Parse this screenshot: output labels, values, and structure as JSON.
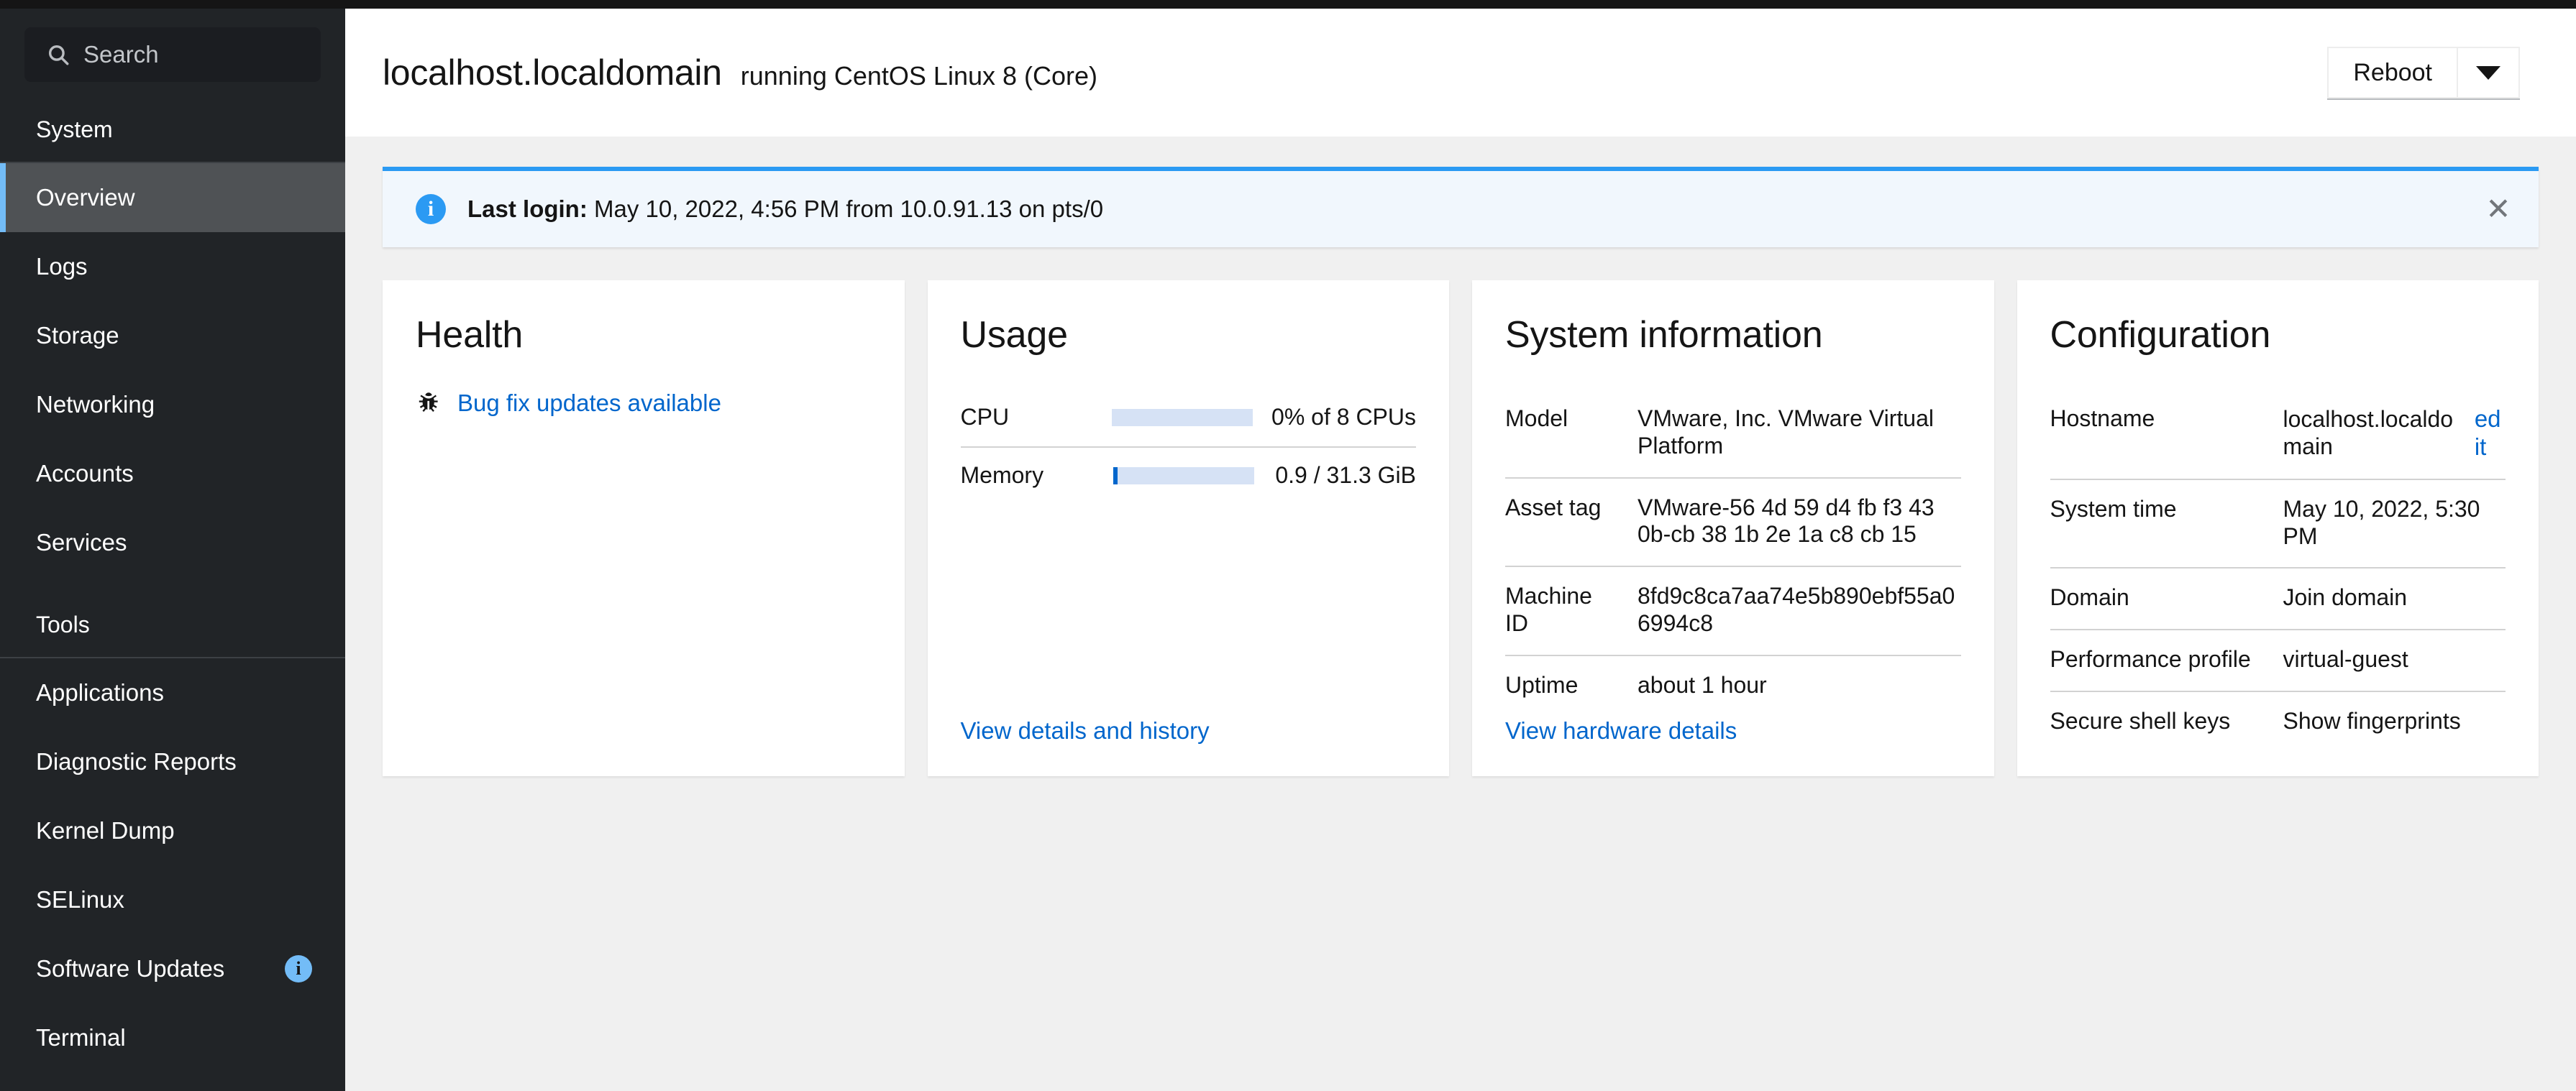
{
  "sidebar": {
    "search": {
      "placeholder": "Search",
      "value": "",
      "icon": "search-icon"
    },
    "sections": [
      {
        "label": "System",
        "items": [
          {
            "label": "Overview",
            "active": true
          },
          {
            "label": "Logs",
            "active": false
          },
          {
            "label": "Storage",
            "active": false
          },
          {
            "label": "Networking",
            "active": false
          },
          {
            "label": "Accounts",
            "active": false
          },
          {
            "label": "Services",
            "active": false
          }
        ]
      },
      {
        "label": "Tools",
        "items": [
          {
            "label": "Applications",
            "active": false
          },
          {
            "label": "Diagnostic Reports",
            "active": false
          },
          {
            "label": "Kernel Dump",
            "active": false
          },
          {
            "label": "SELinux",
            "active": false
          },
          {
            "label": "Software Updates",
            "active": false,
            "badge": "i"
          },
          {
            "label": "Terminal",
            "active": false
          }
        ]
      }
    ]
  },
  "header": {
    "hostname": "localhost.localdomain",
    "running": "running CentOS Linux 8 (Core)",
    "reboot_label": "Reboot",
    "caret_icon": "chevron-down-icon"
  },
  "alert": {
    "icon": "info-icon",
    "label": "Last login:",
    "message": " May 10, 2022, 4:56 PM from 10.0.91.13 on pts/0",
    "close_icon": "✕"
  },
  "cards": {
    "health": {
      "title": "Health",
      "icon": "bug-icon",
      "link": "Bug fix updates available"
    },
    "usage": {
      "title": "Usage",
      "rows": [
        {
          "label": "CPU",
          "value": "0% of 8 CPUs",
          "percent": 0
        },
        {
          "label": "Memory",
          "value": "0.9 / 31.3 GiB",
          "percent": 3
        }
      ],
      "footer_link": "View details and history"
    },
    "system_information": {
      "title": "System information",
      "rows": [
        {
          "key": "Model",
          "value": "VMware, Inc. VMware Virtual Platform"
        },
        {
          "key": "Asset tag",
          "value": "VMware-56 4d 59 d4 fb f3 43 0b-cb 38 1b 2e 1a c8 cb 15"
        },
        {
          "key": "Machine ID",
          "value": "8fd9c8ca7aa74e5b890ebf55a06994c8"
        },
        {
          "key": "Uptime",
          "value": "about 1 hour"
        }
      ],
      "footer_link": "View hardware details"
    },
    "configuration": {
      "title": "Configuration",
      "rows": [
        {
          "key": "Hostname",
          "value": "localhost.localdomain",
          "action": "edit",
          "value_is_link": false
        },
        {
          "key": "System time",
          "value": "May 10, 2022, 5:30 PM",
          "value_is_link": true
        },
        {
          "key": "Domain",
          "value": "Join domain",
          "value_is_link": true
        },
        {
          "key": "Performance profile",
          "value": "virtual-guest",
          "value_is_link": true
        },
        {
          "key": "Secure shell keys",
          "value": "Show fingerprints",
          "value_is_link": true
        }
      ]
    }
  },
  "colors": {
    "sidebar_bg": "#212427",
    "accent_blue": "#06c",
    "alert_border": "#2b9af3",
    "active_item": "#4f5255",
    "active_marker": "#73bcf7"
  }
}
